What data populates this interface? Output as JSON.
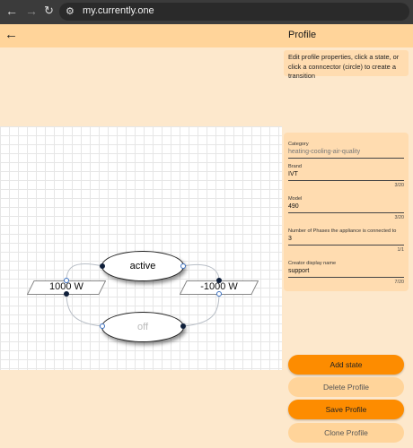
{
  "browser": {
    "back_icon": "arrow-left-icon",
    "forward_icon": "arrow-right-icon",
    "reload_icon": "reload-icon",
    "site_settings_icon": "tune-icon",
    "url": "my.currently.one"
  },
  "header": {
    "back_icon": "arrow-left-icon",
    "title": "Profile"
  },
  "help": {
    "text": "Edit profile properties, click a state, or click a conncector (circle) to create a transition"
  },
  "diagram": {
    "states": [
      {
        "label": "active",
        "color": "#111111"
      },
      {
        "label": "off",
        "color": "#bbbbbb"
      }
    ],
    "transitions": [
      {
        "label": "1000 W"
      },
      {
        "label": "-1000 W"
      }
    ]
  },
  "form": {
    "category": {
      "label": "Category",
      "value": "heating-cooling-air-quality"
    },
    "brand": {
      "label": "Brand",
      "value": "IVT",
      "counter": "3/20"
    },
    "model": {
      "label": "Model",
      "value": "490",
      "counter": "3/20"
    },
    "phases": {
      "label": "Number of Phases the appliance is connected to",
      "value": "3",
      "counter": "1/1"
    },
    "creator": {
      "label": "Creator display name",
      "value": "support",
      "counter": "7/20"
    }
  },
  "actions": {
    "add_state": "Add state",
    "delete_profile": "Delete Profile",
    "save_profile": "Save Profile",
    "clone_profile": "Clone Profile"
  },
  "colors": {
    "accent": "#fd8c00",
    "panel": "#ffdcb0",
    "header": "#ffd49a",
    "background": "#fde8cc"
  }
}
